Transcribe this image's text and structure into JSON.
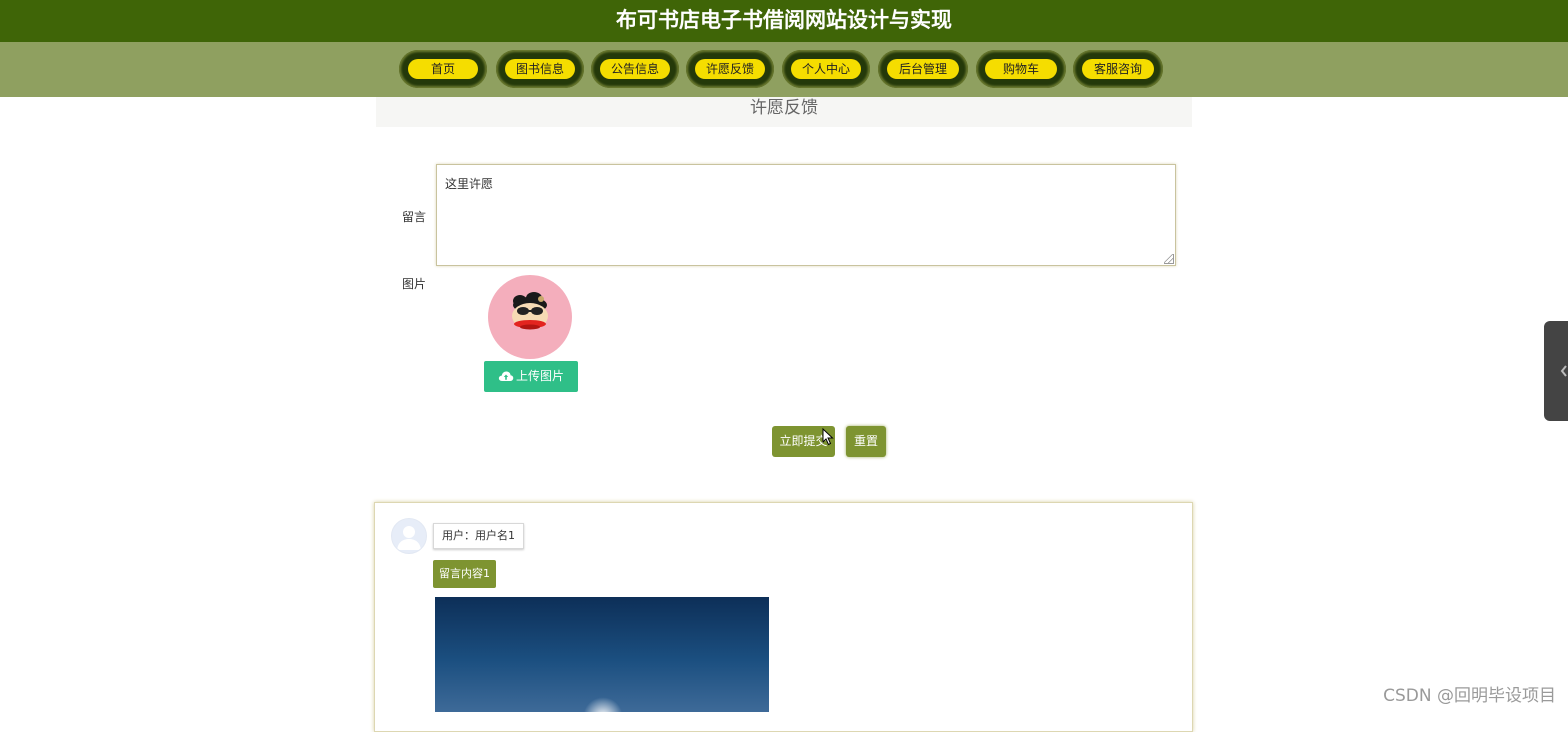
{
  "site": {
    "title": "布可书店电子书借阅网站设计与实现"
  },
  "nav": {
    "items": [
      {
        "label": "首页"
      },
      {
        "label": "图书信息"
      },
      {
        "label": "公告信息"
      },
      {
        "label": "许愿反馈"
      },
      {
        "label": "个人中心"
      },
      {
        "label": "后台管理"
      },
      {
        "label": "购物车"
      },
      {
        "label": "客服咨询"
      }
    ]
  },
  "page": {
    "heading": "许愿反馈"
  },
  "form": {
    "message_label": "留言",
    "message_value": "这里许愿",
    "image_label": "图片",
    "upload_label": "上传图片",
    "submit_label": "立即提交",
    "reset_label": "重置"
  },
  "comments": [
    {
      "user": "用户：用户名1",
      "content": "留言内容1"
    }
  ],
  "watermark": "CSDN @回明毕设项目",
  "colors": {
    "header": "#3f6507",
    "navbar": "#8fa060",
    "nav_pill": "#f5dd00",
    "accent": "#7e9431",
    "upload": "#2fbf88"
  }
}
